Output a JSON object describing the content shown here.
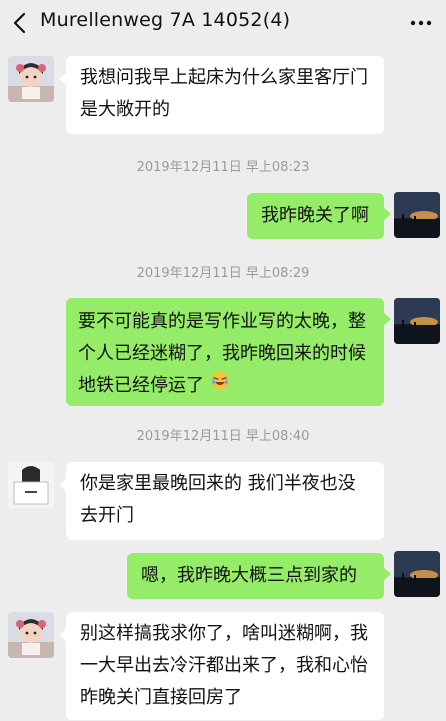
{
  "header": {
    "title": "Murellenweg 7A 14052(4)",
    "back_icon": "chevron-left-icon",
    "more_icon": "more-dots-icon"
  },
  "messages": [
    {
      "side": "in",
      "avatar": "girl-avatar",
      "text": "我想问我早上起床为什么家里客厅门是大敞开的"
    },
    {
      "timestamp": "2019年12月11日 早上08:23"
    },
    {
      "side": "out",
      "avatar": "sunset-avatar",
      "text": "我昨晚关了啊"
    },
    {
      "timestamp": "2019年12月11日 早上08:29"
    },
    {
      "side": "out",
      "avatar": "sunset-avatar",
      "text": "要不可能真的是写作业写的太晚，整个人已经迷糊了，我昨晚回来的时候地铁已经停运了",
      "emoji": "laughing-crying-emoji"
    },
    {
      "timestamp": "2019年12月11日 早上08:40"
    },
    {
      "side": "in",
      "avatar": "laptop-avatar",
      "text": "你是家里最晚回来的 我们半夜也没去开门"
    },
    {
      "side": "out",
      "avatar": "sunset-avatar",
      "text": "嗯，我昨晚大概三点到家的"
    },
    {
      "side": "in",
      "avatar": "girl-avatar",
      "text": "别这样搞我求你了，啥叫迷糊啊，我一大早出去冷汗都出来了，我和心怡昨晚关门直接回房了"
    }
  ],
  "colors": {
    "background": "#ededed",
    "incoming_bubble": "#ffffff",
    "outgoing_bubble": "#95ec69",
    "timestamp_text": "#9a9a9a"
  }
}
